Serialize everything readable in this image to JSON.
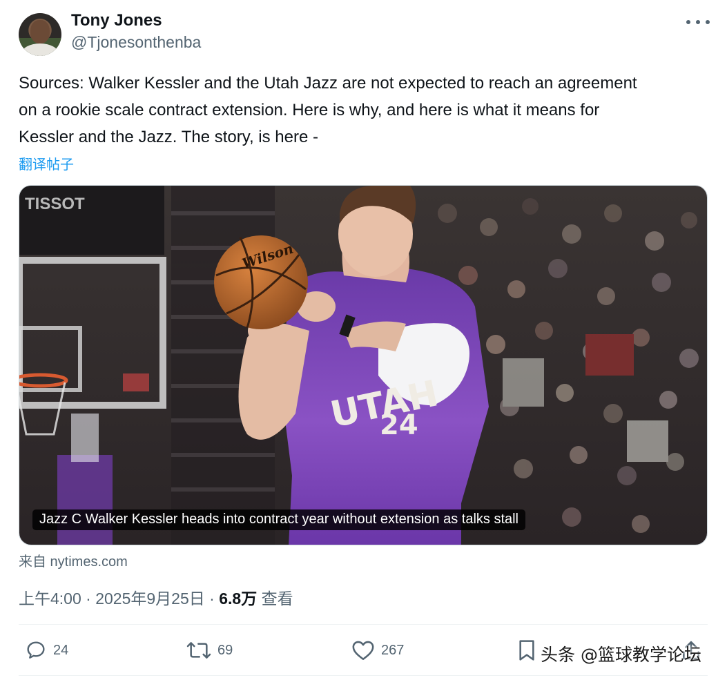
{
  "author": {
    "display_name": "Tony Jones",
    "handle": "@Tjonesonthenba"
  },
  "tweet": {
    "text_lines": [
      "Sources: Walker Kessler and the Utah Jazz are not expected to reach an agreement",
      "on a rookie scale contract extension. Here is why, and here is what it means for",
      "Kessler and the Jazz. The story, is here -"
    ],
    "translate_label": "翻译帖子"
  },
  "media": {
    "caption": "Jazz C Walker Kessler heads into contract year without extension as talks stall",
    "jersey_team": "UTAH",
    "jersey_number": "24",
    "ball_brand": "Wilson",
    "sponsor_board": "TISSOT",
    "source_label": "来自 nytimes.com"
  },
  "meta": {
    "time": "上午4:00",
    "separator": "·",
    "date": "2025年9月25日",
    "views_count": "6.8万",
    "views_label": "查看"
  },
  "actions": {
    "replies": "24",
    "retweets": "69",
    "likes": "267"
  },
  "watermark": "头条 @篮球教学论坛",
  "colors": {
    "link": "#1d9bf0",
    "secondary_text": "#536471",
    "primary_text": "#0f1419",
    "jersey": "#7b3fb8"
  },
  "icons": [
    "more-icon",
    "reply-icon",
    "retweet-icon",
    "like-icon",
    "bookmark-icon",
    "share-icon"
  ]
}
